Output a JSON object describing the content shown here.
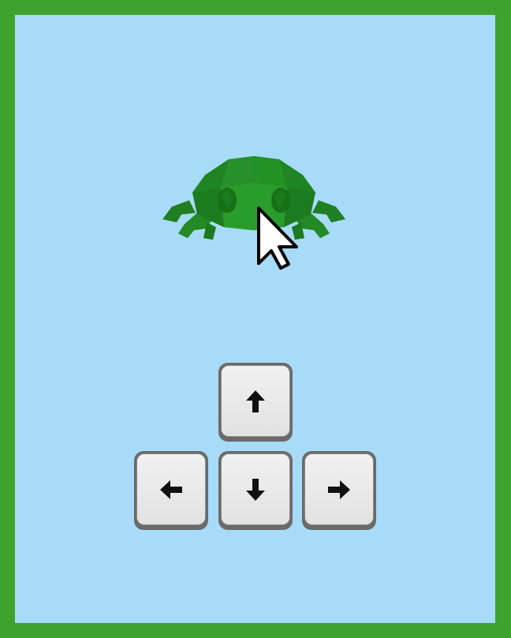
{
  "game": {
    "scene": "frog on water",
    "colors": {
      "border": "#3ea32e",
      "water": "#a8dbf8",
      "frog_dark": "#1c7a1f",
      "frog_light": "#2d9a2b",
      "key_face": "#e8e8e8",
      "key_edge": "#6a6a6a"
    }
  },
  "controls": {
    "keys": [
      {
        "id": "up",
        "icon": "arrow-up-icon"
      },
      {
        "id": "left",
        "icon": "arrow-left-icon"
      },
      {
        "id": "down",
        "icon": "arrow-down-icon"
      },
      {
        "id": "right",
        "icon": "arrow-right-icon"
      }
    ]
  },
  "cursor": {
    "icon": "mouse-pointer-icon"
  }
}
